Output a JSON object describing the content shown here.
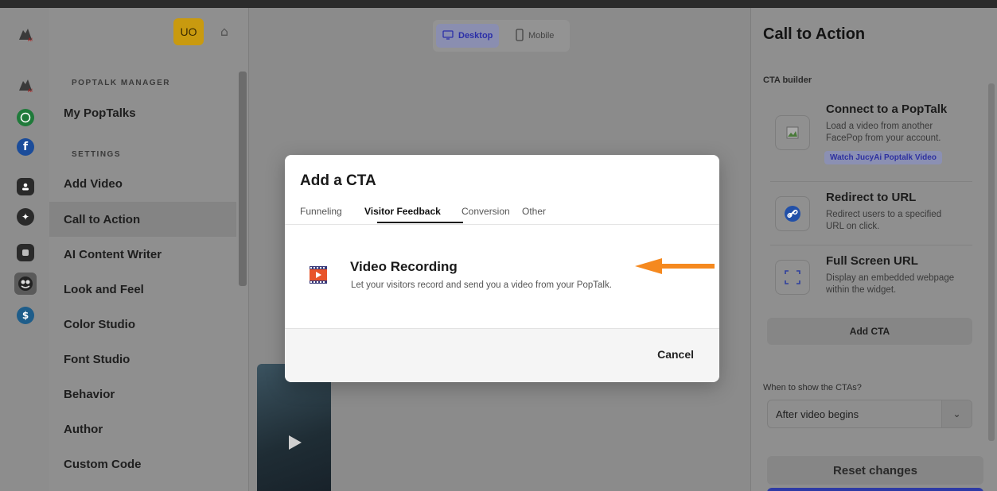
{
  "colors": {
    "avatar_bg": "#c99a0f",
    "accent": "#2b2fa8",
    "annotation_arrow": "#f5891f",
    "recording_icon": "#e8542a"
  },
  "rail": {
    "icons": [
      "brand-logo-icon",
      "brand-logo-icon",
      "whatsapp-icon",
      "facebook-icon",
      "contact-icon",
      "ai-sparkle-icon",
      "chat-icon",
      "cartoon-avatar-icon",
      "dollar-icon"
    ]
  },
  "sidebar": {
    "avatar_initials": "UO",
    "section_manager": "POPTALK MANAGER",
    "my_poptalks": "My PopTalks",
    "section_settings": "SETTINGS",
    "items": [
      {
        "label": "Add Video"
      },
      {
        "label": "Call to Action"
      },
      {
        "label": "AI Content Writer"
      },
      {
        "label": "Look and Feel"
      },
      {
        "label": "Color Studio"
      },
      {
        "label": "Font Studio"
      },
      {
        "label": "Behavior"
      },
      {
        "label": "Author"
      },
      {
        "label": "Custom Code"
      }
    ],
    "active_item": "Call to Action"
  },
  "preview": {
    "desktop_label": "Desktop",
    "mobile_label": "Mobile"
  },
  "modal": {
    "title": "Add a CTA",
    "tabs": [
      "Funneling",
      "Visitor Feedback",
      "Conversion",
      "Other"
    ],
    "active_tab": "Visitor Feedback",
    "option_title": "Video Recording",
    "option_desc": "Let your visitors record and send you a video from your PopTalk.",
    "cancel_label": "Cancel"
  },
  "panel": {
    "title": "Call to Action",
    "builder_label": "CTA builder",
    "ctas": [
      {
        "title": "Connect to a PopTalk",
        "desc": "Load a video from another FacePop from your account.",
        "icon": "broken-image-icon"
      },
      {
        "title": "Redirect to URL",
        "desc": "Redirect users to a specified URL on click.",
        "icon": "link-icon"
      },
      {
        "title": "Full Screen URL",
        "desc": "Display an embedded webpage within the widget.",
        "icon": "fullscreen-icon"
      }
    ],
    "watch_label": "Watch JucyAi Poptalk Video",
    "add_cta_label": "Add CTA",
    "when_label": "When to show the CTAs?",
    "when_value": "After video begins",
    "reset_label": "Reset changes"
  }
}
